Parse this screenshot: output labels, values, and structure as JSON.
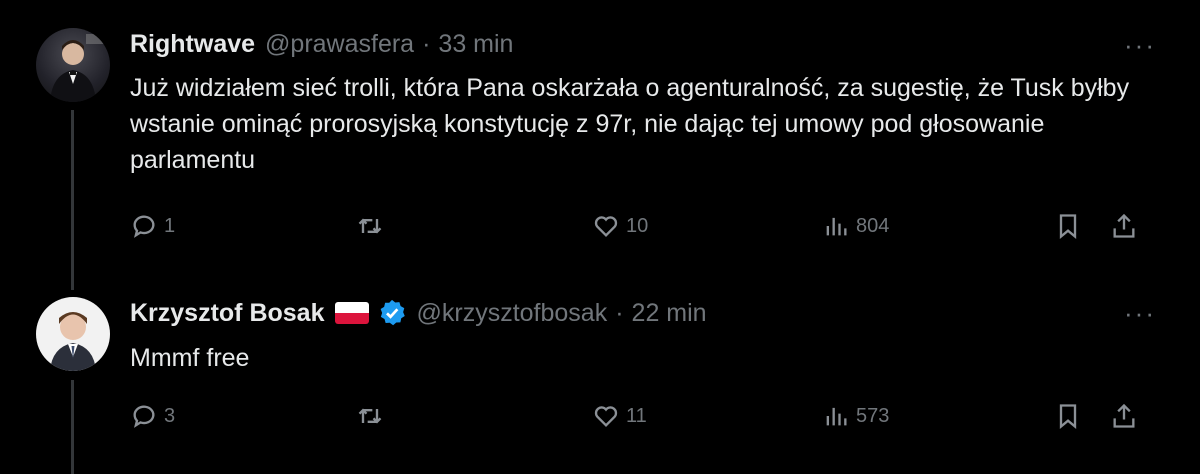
{
  "tweets": [
    {
      "name": "Rightwave",
      "handle": "@prawasfera",
      "separator": "·",
      "time": "33 min",
      "text": "Już widziałem sieć trolli, która Pana oskarżała o agenturalność, za sugestię, że Tusk byłby wstanie ominąć prorosyjską konstytucję z 97r, nie dając tej umowy pod głosowanie parlamentu",
      "more": "···",
      "replies": "1",
      "reposts": "",
      "likes": "10",
      "views": "804"
    },
    {
      "name": "Krzysztof Bosak",
      "handle": "@krzysztofbosak",
      "separator": "·",
      "time": "22 min",
      "text": "Mmmf free",
      "more": "···",
      "replies": "3",
      "reposts": "",
      "likes": "11",
      "views": "573"
    }
  ],
  "colors": {
    "background": "#000000",
    "text": "#e7e9ea",
    "muted": "#71767b",
    "verified": "#1d9bf0",
    "flag_white": "#ffffff",
    "flag_red": "#dc143c"
  },
  "icons": [
    "reply-icon",
    "repost-icon",
    "like-icon",
    "views-icon",
    "bookmark-icon",
    "share-icon",
    "more-icon",
    "verified-badge-icon",
    "poland-flag-icon"
  ]
}
